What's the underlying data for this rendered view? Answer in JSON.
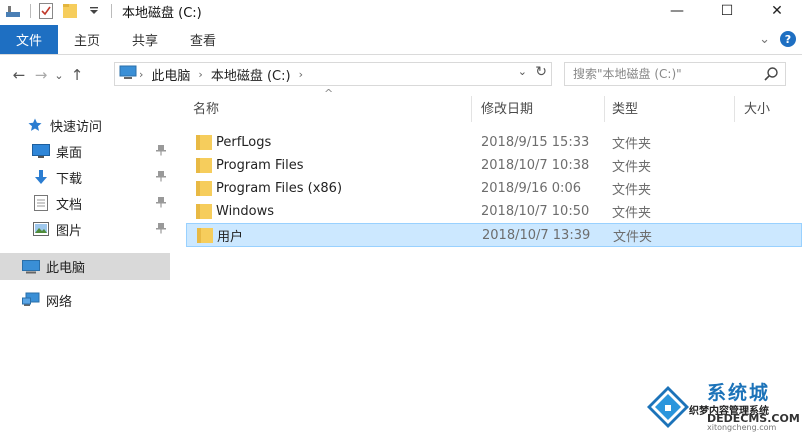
{
  "window": {
    "title": "本地磁盘 (C:)",
    "minimize_glyph": "—",
    "maximize_glyph": "☐",
    "close_glyph": "✕"
  },
  "quick_access_toolbar": {
    "icons": [
      "properties-icon",
      "checkmark-doc-icon",
      "new-folder-icon",
      "customize-dropdown-icon"
    ]
  },
  "ribbon": {
    "tabs": [
      {
        "label": "文件",
        "active": true
      },
      {
        "label": "主页"
      },
      {
        "label": "共享"
      },
      {
        "label": "查看"
      }
    ],
    "expand_glyph": "⌄",
    "help_glyph": "?"
  },
  "address_bar": {
    "back_glyph": "←",
    "forward_glyph": "→",
    "recent_glyph": "⌄",
    "up_glyph": "↑",
    "breadcrumbs": [
      "此电脑",
      "本地磁盘 (C:)"
    ],
    "separator": "›",
    "dropdown_glyph": "⌄",
    "refresh_glyph": "↻"
  },
  "search": {
    "placeholder": "搜索\"本地磁盘 (C:)\""
  },
  "nav_pane": {
    "quick_access": "快速访问",
    "items": [
      {
        "label": "桌面",
        "pinned": true
      },
      {
        "label": "下载",
        "pinned": true
      },
      {
        "label": "文档",
        "pinned": true
      },
      {
        "label": "图片",
        "pinned": true
      }
    ],
    "pin_glyph": "📌",
    "this_pc": "此电脑",
    "network": "网络"
  },
  "columns": {
    "name": "名称",
    "date": "修改日期",
    "type": "类型",
    "size": "大小",
    "sort_glyph": "^"
  },
  "files": [
    {
      "name": "PerfLogs",
      "date": "2018/9/15 15:33",
      "type": "文件夹"
    },
    {
      "name": "Program Files",
      "date": "2018/10/7 10:38",
      "type": "文件夹"
    },
    {
      "name": "Program Files (x86)",
      "date": "2018/9/16 0:06",
      "type": "文件夹"
    },
    {
      "name": "Windows",
      "date": "2018/10/7 10:50",
      "type": "文件夹"
    },
    {
      "name": "用户",
      "date": "2018/10/7 13:39",
      "type": "文件夹",
      "selected": true
    }
  ],
  "watermark": {
    "title": "系统城",
    "subtitle": "织梦内容管理系统",
    "domain": "DEDECMS.COM",
    "url": "xitongcheng.com"
  },
  "colors": {
    "accent": "#1e6fc2",
    "selection_bg": "#cce8ff",
    "selection_border": "#99d1ff",
    "folder": "#f6cd5c",
    "nav_selected": "#d9d9d9"
  }
}
